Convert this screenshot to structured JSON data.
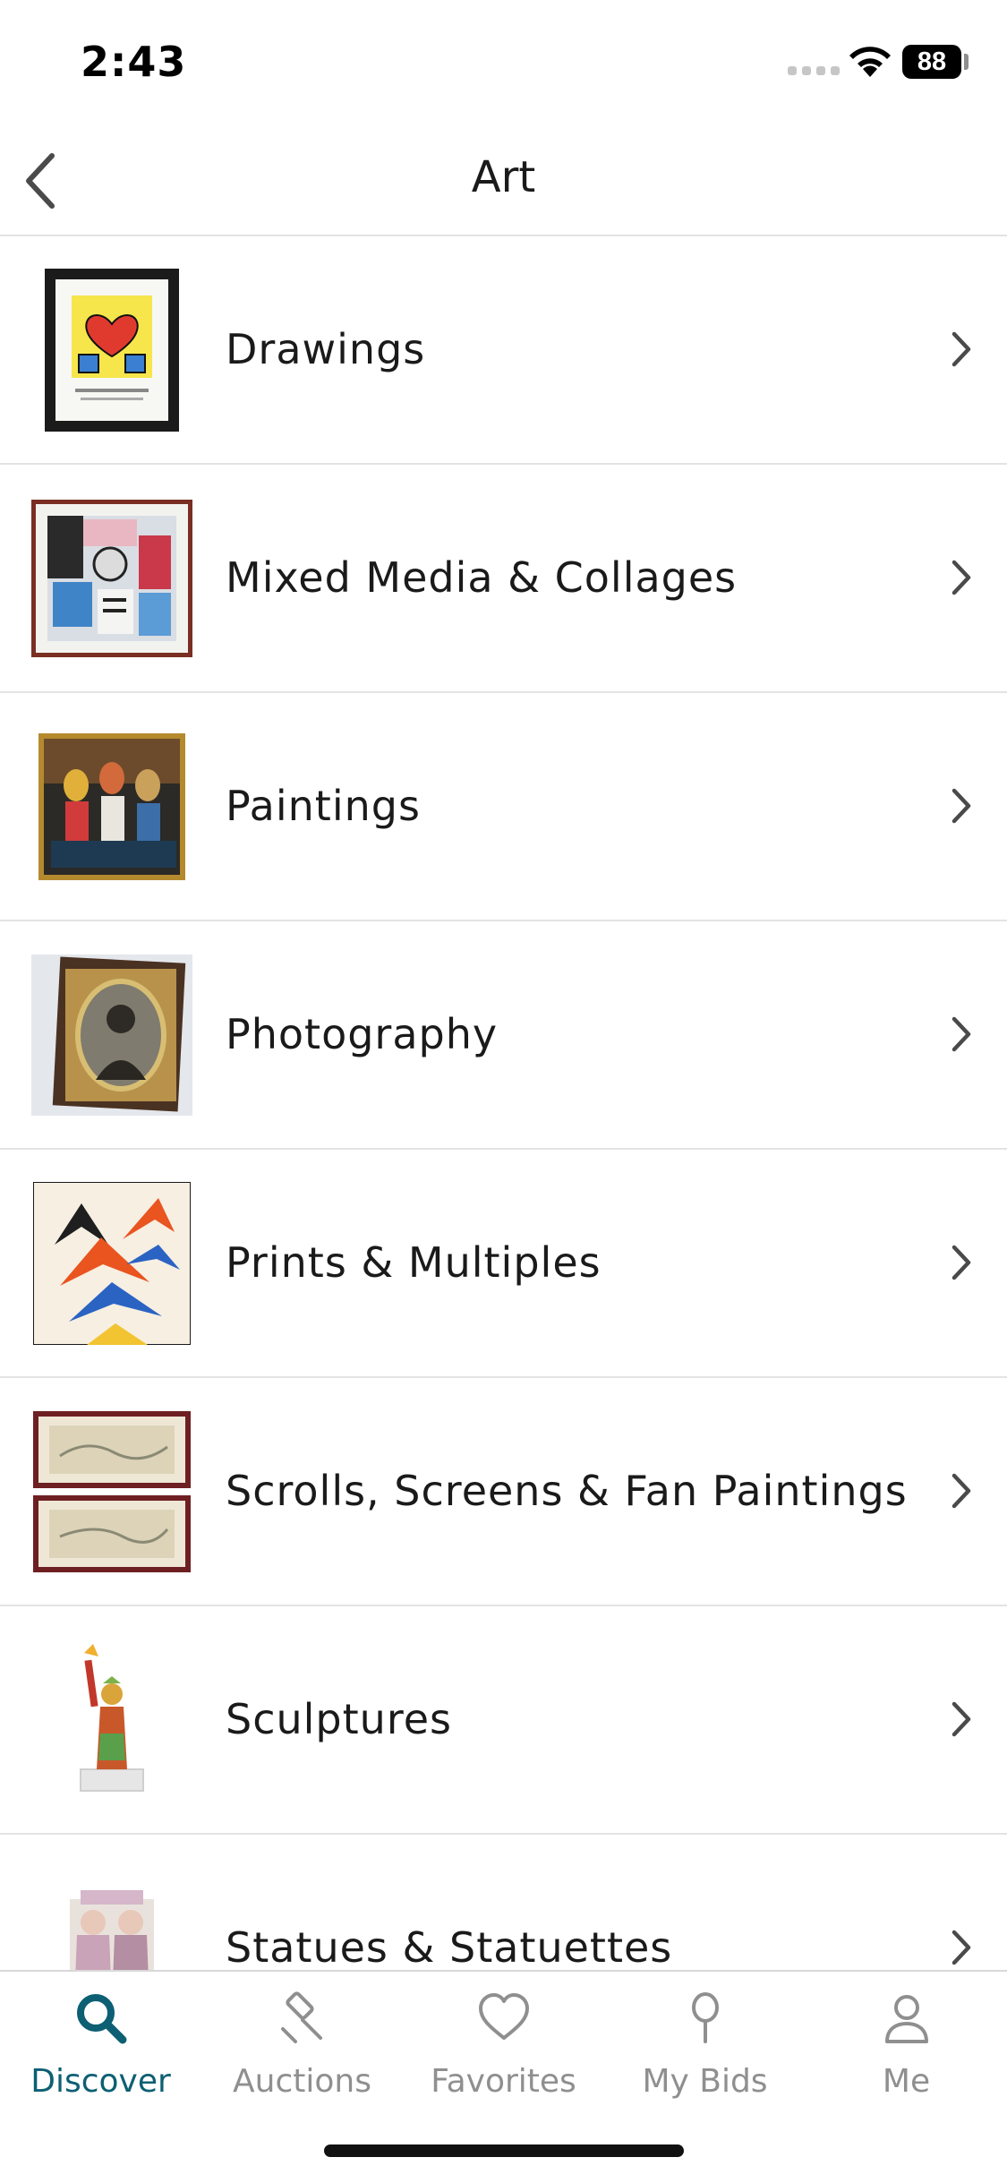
{
  "status_bar": {
    "time": "2:43",
    "battery": "88"
  },
  "nav": {
    "title": "Art",
    "back_icon": "chevron-left-icon"
  },
  "categories": [
    {
      "label": "Drawings",
      "icon": "drawing-thumbnail"
    },
    {
      "label": "Mixed Media & Collages",
      "icon": "collage-thumbnail"
    },
    {
      "label": "Paintings",
      "icon": "painting-thumbnail"
    },
    {
      "label": "Photography",
      "icon": "photograph-thumbnail"
    },
    {
      "label": "Prints & Multiples",
      "icon": "print-thumbnail"
    },
    {
      "label": "Scrolls, Screens & Fan Paintings",
      "icon": "scroll-thumbnail"
    },
    {
      "label": "Sculptures",
      "icon": "sculpture-thumbnail"
    },
    {
      "label": "Statues & Statuettes",
      "icon": "statuette-thumbnail"
    }
  ],
  "tabs": [
    {
      "label": "Discover",
      "icon": "search-icon",
      "active": true
    },
    {
      "label": "Auctions",
      "icon": "gavel-icon",
      "active": false
    },
    {
      "label": "Favorites",
      "icon": "heart-icon",
      "active": false
    },
    {
      "label": "My Bids",
      "icon": "paddle-icon",
      "active": false
    },
    {
      "label": "Me",
      "icon": "person-icon",
      "active": false
    }
  ],
  "colors": {
    "accent": "#0d5f73",
    "inactive": "#8f8f8f",
    "divider": "#e3e3e3"
  }
}
